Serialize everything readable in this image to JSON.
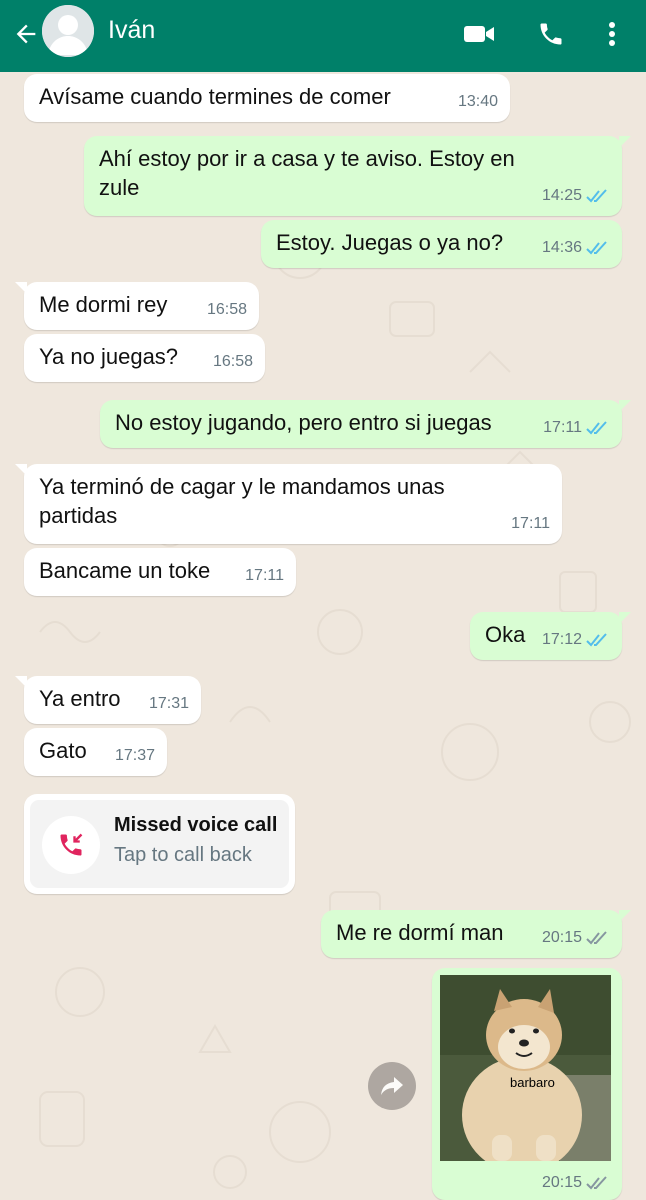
{
  "header": {
    "contact_name": "Iván",
    "icons": [
      "back-arrow-icon",
      "avatar",
      "video-call-icon",
      "phone-icon",
      "more-options-icon"
    ]
  },
  "colors": {
    "header_bg": "#008069",
    "outgoing_bubble": "#d9fdd3",
    "incoming_bubble": "#ffffff",
    "read_ticks": "#53bdeb",
    "delivered_ticks": "#8696a0",
    "missed_call_red": "#e0245e"
  },
  "messages": [
    {
      "dir": "in",
      "text": "Avísame cuando termines de comer",
      "time": "13:40"
    },
    {
      "dir": "out",
      "text": "Ahí estoy por ir a casa y te aviso. Estoy en zule",
      "time": "14:25",
      "status": "read"
    },
    {
      "dir": "out",
      "text": "Estoy. Juegas o ya no?",
      "time": "14:36",
      "status": "read"
    },
    {
      "dir": "in",
      "text": "Me dormi rey",
      "time": "16:58"
    },
    {
      "dir": "in",
      "text": "Ya no juegas?",
      "time": "16:58"
    },
    {
      "dir": "out",
      "text": "No estoy jugando, pero entro si juegas",
      "time": "17:11",
      "status": "read"
    },
    {
      "dir": "in",
      "text": "Ya terminó de cagar y le mandamos unas partidas",
      "time": "17:11"
    },
    {
      "dir": "in",
      "text": "Bancame un toke",
      "time": "17:11"
    },
    {
      "dir": "out",
      "text": "Oka",
      "time": "17:12",
      "status": "read"
    },
    {
      "dir": "in",
      "text": "Ya entro",
      "time": "17:31"
    },
    {
      "dir": "in",
      "text": "Gato",
      "time": "17:37"
    },
    {
      "dir": "out",
      "text": "Me re dormí man",
      "time": "20:15",
      "status": "delivered"
    }
  ],
  "missed_call": {
    "title": "Missed voice call",
    "subtitle": "Tap to call back"
  },
  "image_message": {
    "caption": "barbaro",
    "time": "20:15",
    "status": "delivered"
  }
}
